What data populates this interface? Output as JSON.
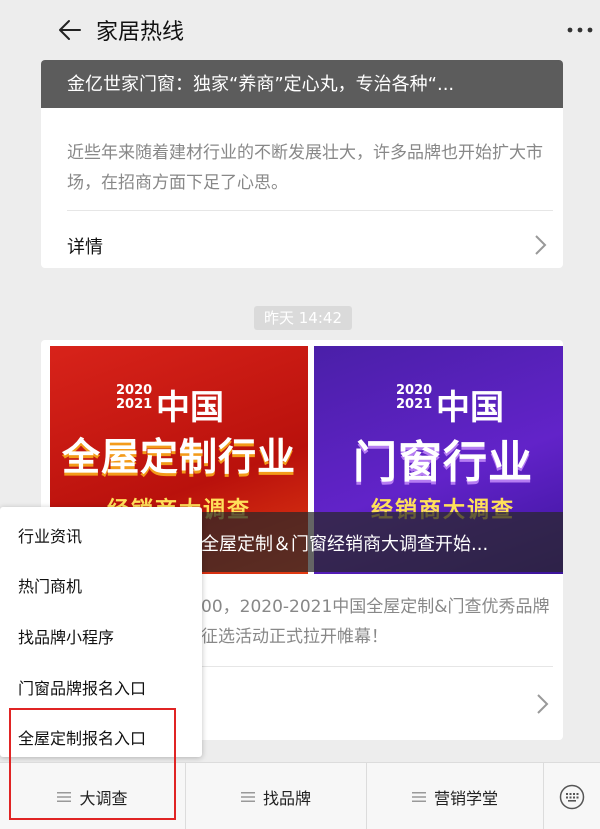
{
  "header": {
    "title": "家居热线"
  },
  "card1": {
    "banner_title": "金亿世家门窗：独家“养商”定心丸，专治各种“...",
    "description": "近些年来随着建材行业的不断发展壮大，许多品牌也开始扩大市场，在招商方面下足了心思。",
    "detail_label": "详情"
  },
  "timestamp": "昨天 14:42",
  "card2": {
    "thumb_left": {
      "year_top": "2020",
      "year_bottom": "2021",
      "china": "中国",
      "main": "全屋定制行业",
      "sub": "经销商大调查"
    },
    "thumb_right": {
      "year_top": "2020",
      "year_bottom": "2021",
      "china": "中国",
      "main": "门窗行业",
      "sub": "经销商大调查"
    },
    "caption": "全屋定制＆门窗经销商大调查开始...",
    "description": "00，2020-2021中国全屋定制&门查优秀品牌征选活动正式拉开帷幕！"
  },
  "popup_menu": {
    "items": [
      "行业资讯",
      "热门商机",
      "找品牌小程序",
      "门窗品牌报名入口",
      "全屋定制报名入口"
    ]
  },
  "bottom_bar": {
    "tabs": [
      "大调查",
      "找品牌",
      "营销学堂"
    ]
  },
  "colors": {
    "highlight": "#e02424",
    "left_thumb": "#d8231a",
    "right_thumb": "#5a22c0"
  }
}
